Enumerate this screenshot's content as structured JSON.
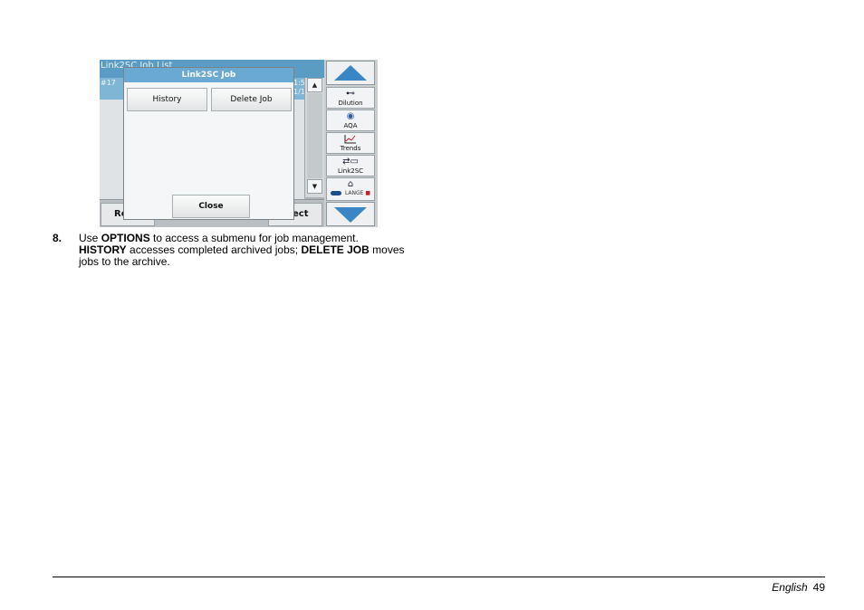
{
  "screenshot": {
    "bg_title": "Link2SC Job List",
    "bg_row_id": "#17",
    "bg_row_num": "1:50",
    "bg_row_page": "1/1",
    "bottom_left_label": "Re",
    "bottom_right_label": "ect",
    "dialog": {
      "title": "Link2SC Job",
      "history_label": "History",
      "delete_label": "Delete Job",
      "close_label": "Close"
    },
    "side_panel": {
      "dilution_label": "Dilution",
      "aqa_label": "AQA",
      "trends_label": "Trends",
      "link2sc_label": "Link2SC",
      "lange_label": "LANGE"
    },
    "colors": {
      "header_blue": "#5b9cc4",
      "arrow_blue": "#3a86c4",
      "lange_red": "#c2202a"
    }
  },
  "step": {
    "number": "8.",
    "t1": "Use ",
    "b1": "OPTIONS",
    "t2": " to access a submenu for job management. ",
    "b2": "HISTORY",
    "t3": " accesses completed archived jobs; ",
    "b3": "DELETE JOB",
    "t4": " moves jobs to the archive."
  },
  "footer": {
    "language": "English",
    "page": "49"
  }
}
